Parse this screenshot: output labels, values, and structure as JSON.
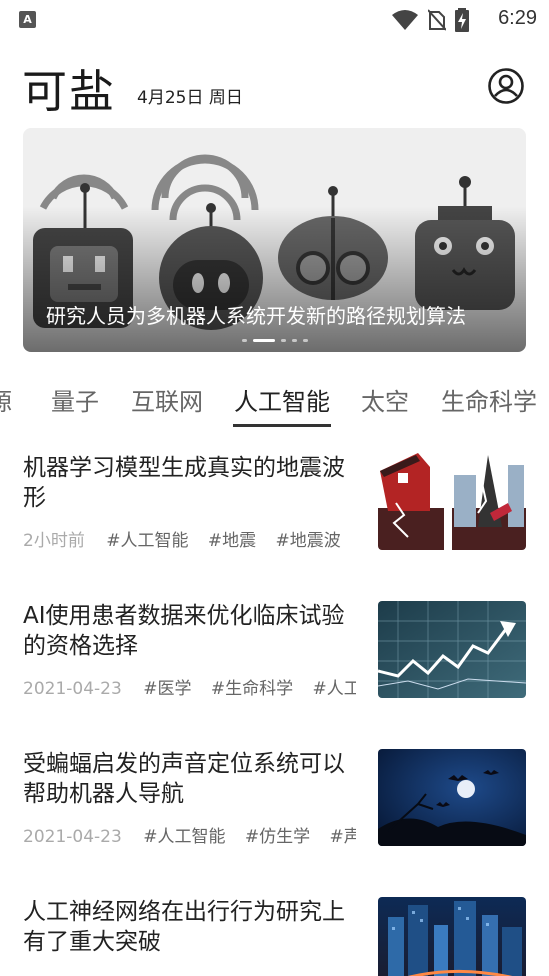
{
  "status_bar": {
    "time": "6:29",
    "icons": [
      "app-a-icon",
      "wifi-icon",
      "no-sim-icon",
      "battery-charging-icon"
    ]
  },
  "header": {
    "logo": "可盐",
    "date": "4月25日 周日"
  },
  "banner": {
    "caption": "研究人员为多机器人系统开发新的路径规划算法",
    "page_count": 5,
    "active_page": 2
  },
  "tabs": {
    "items": [
      "源",
      "量子",
      "互联网",
      "人工智能",
      "太空",
      "生命科学"
    ],
    "active_index": 3
  },
  "articles": [
    {
      "title": "机器学习模型生成真实的地震波形",
      "time": "2小时前",
      "tags": [
        "#人工智能",
        "#地震",
        "#地震波",
        "#"
      ],
      "thumb": "earthquake-illustration"
    },
    {
      "title": "AI使用患者数据来优化临床试验的资格选择",
      "time": "2021-04-23",
      "tags": [
        "#医学",
        "#生命科学",
        "#人工智能"
      ],
      "thumb": "stock-chart-image"
    },
    {
      "title": "受蝙蝠启发的声音定位系统可以帮助机器人导航",
      "time": "2021-04-23",
      "tags": [
        "#人工智能",
        "#仿生学",
        "#声音"
      ],
      "thumb": "bats-moon-image"
    },
    {
      "title": "人工神经网络在出行行为研究上有了重大突破",
      "time": "",
      "tags": [],
      "thumb": "city-night-traffic-image"
    }
  ]
}
